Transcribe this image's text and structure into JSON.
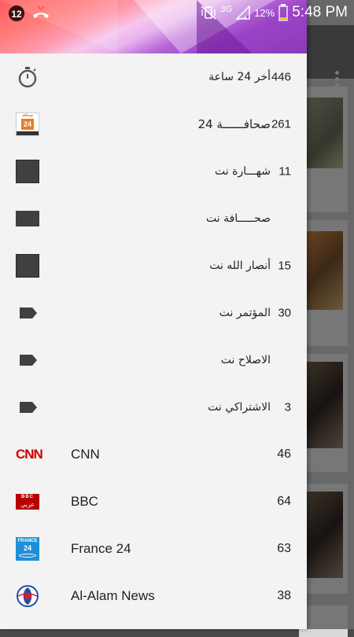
{
  "status_bar": {
    "notification_count": "12",
    "network_type": "3G",
    "battery_percent": "12%",
    "time": "5:48 PM"
  },
  "drawer": {
    "items": [
      {
        "title": "أخر 24 ساعة",
        "count": "446",
        "icon": "stopwatch-icon"
      },
      {
        "title": "صحافــــــة 24",
        "count": "261",
        "icon": "sahafa24-logo"
      },
      {
        "title": "شهـــارة نت",
        "count": "11",
        "icon": "placeholder-square-icon"
      },
      {
        "title": "صحـــــافة نت",
        "count": "",
        "icon": "placeholder-rect-icon"
      },
      {
        "title": "أنصار الله نت",
        "count": "15",
        "icon": "placeholder-square-icon"
      },
      {
        "title": "المؤتمر نت",
        "count": "30",
        "icon": "tag-icon"
      },
      {
        "title": "الاصلاح نت",
        "count": "",
        "icon": "tag-icon"
      },
      {
        "title": "الاشتراكي نت",
        "count": "3",
        "icon": "tag-icon"
      },
      {
        "title": "CNN",
        "count": "46",
        "icon": "cnn-logo"
      },
      {
        "title": "BBC",
        "count": "64",
        "icon": "bbc-arabic-logo"
      },
      {
        "title": "France 24",
        "count": "63",
        "icon": "france24-logo"
      },
      {
        "title": "Al-Alam News",
        "count": "38",
        "icon": "alalam-logo"
      }
    ]
  },
  "logos": {
    "bbc_sub": "عربي",
    "bbc_text": "BBC",
    "france24_line1": "FRANCE",
    "france24_line2": "24",
    "sahafa_top": "صحافة",
    "sahafa_num": "24",
    "cnn_text": "CNN"
  },
  "colors": {
    "drawer_bg": "#f3f3f3",
    "icon_dark": "#404040",
    "cnn_red": "#cc0000",
    "bbc_red": "#b80000",
    "france24_blue": "#1e8fd6"
  }
}
